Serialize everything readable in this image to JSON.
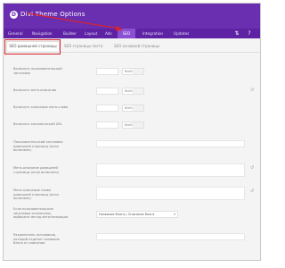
{
  "app": {
    "logo_letter": "D",
    "title": "Divi Theme Options"
  },
  "nav": {
    "items": [
      "General",
      "Navigation",
      "Builder",
      "Layout",
      "Ads",
      "SEO",
      "Integration",
      "Updates"
    ],
    "active": "SEO"
  },
  "subtabs": {
    "items": [
      "SEO домашней страницы",
      "SEO страницы поста",
      "SEO основной страницы"
    ],
    "active_index": 0
  },
  "settings": {
    "rows": [
      "Включить пользовательский заголовок",
      "Включить мета-описание",
      "Включить ключевые мета-слова",
      "Включить канонический URL",
      "Пользовательский заголовок домашней страницы (если включено)",
      "Мета-описание домашней страницы (если включено)",
      "Мета-ключевые слова домашней страницы (если включено)",
      "Если пользовательские заголовки отключены, выберите метод автогенерации",
      "Разделитель заголовков, который отделит название блога от описания"
    ],
    "toggle_value": "ВЫКЛ",
    "select_value": "Название блога | Описание блога"
  },
  "colors": {
    "brand_purple": "#6a2fb0",
    "nav_purple": "#5d23a4",
    "active_tab": "#8b4fd3",
    "highlight_red": "#d9232e"
  }
}
